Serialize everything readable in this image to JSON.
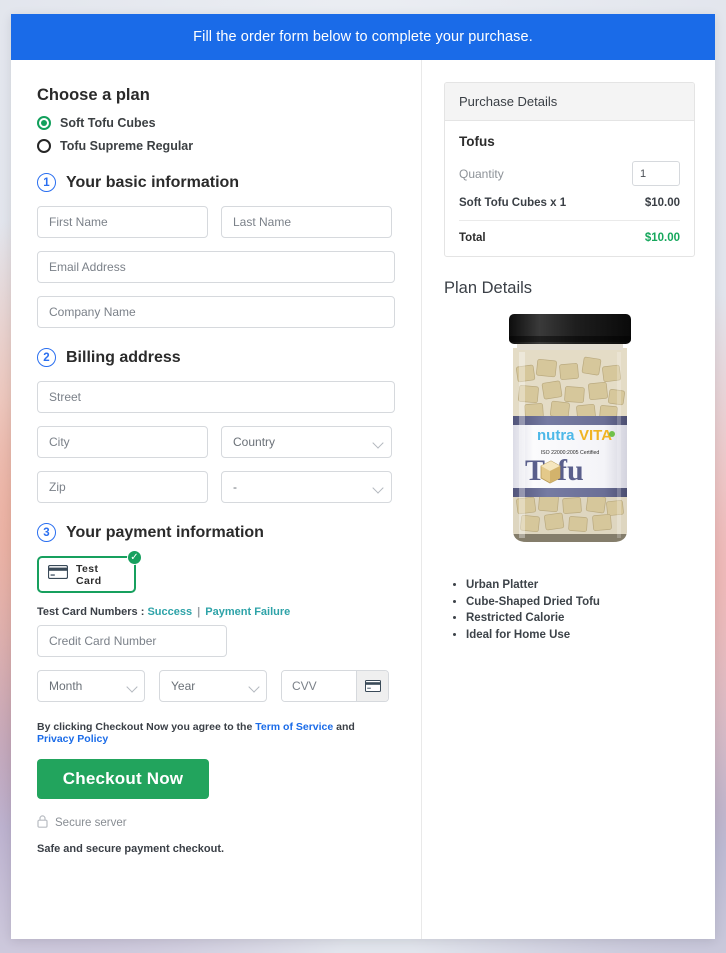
{
  "banner": {
    "text": "Fill the order form below to complete your purchase."
  },
  "plan": {
    "heading": "Choose a plan",
    "options": [
      {
        "label": "Soft Tofu Cubes",
        "selected": true
      },
      {
        "label": "Tofu Supreme Regular",
        "selected": false
      }
    ]
  },
  "steps": [
    {
      "number": "1",
      "label": "Your basic information"
    },
    {
      "number": "2",
      "label": "Billing address"
    },
    {
      "number": "3",
      "label": "Your payment information"
    }
  ],
  "basic_info": {
    "first_name_placeholder": "First Name",
    "last_name_placeholder": "Last Name",
    "email_placeholder": "Email Address",
    "company_placeholder": "Company Name"
  },
  "billing": {
    "street_placeholder": "Street",
    "city_placeholder": "City",
    "country_value": "Country",
    "zip_placeholder": "Zip",
    "state_value": "-"
  },
  "payment": {
    "method_label": "Test Card",
    "method_selected_icon": "check-icon",
    "card_icon": "credit-card-icon",
    "test_numbers_label": "Test Card Numbers :",
    "link_success": "Success",
    "link_separator": "|",
    "link_failure": "Payment Failure",
    "card_number_placeholder": "Credit Card Number",
    "month_value": "Month",
    "year_value": "Year",
    "cvv_placeholder": "CVV"
  },
  "terms": {
    "prefix": "By clicking Checkout Now you agree to the ",
    "link_terms": "Term of Service",
    "conjunction": " and ",
    "link_privacy": "Privacy Policy"
  },
  "checkout": {
    "button_label": "Checkout Now",
    "secure_label": "Secure server",
    "secure_icon": "lock-icon",
    "safe_note": "Safe and secure payment checkout."
  },
  "purchase_details": {
    "header": "Purchase Details",
    "product_name": "Tofus",
    "quantity_label": "Quantity",
    "quantity_value": "1",
    "line_item_label": "Soft Tofu Cubes x 1",
    "line_item_amount": "$10.00",
    "total_label": "Total",
    "total_amount": "$10.00"
  },
  "plan_details": {
    "title": "Plan Details",
    "product_image": {
      "brand_primary": "nutra",
      "brand_secondary": "VITA",
      "certification": "ISO 22000:2005 Certified",
      "product_word": "Tofu",
      "lid_color": "#1c1c1c",
      "label_band_color": "#6a6d96",
      "cube_color": "#d8c89a"
    },
    "features": [
      "Urban Platter",
      "Cube-Shaped Dried Tofu",
      "Restricted Calorie",
      "Ideal for Home Use"
    ]
  },
  "colors": {
    "banner_blue": "#1A6BE8",
    "accent_green": "#22a45d",
    "step_blue": "#2a6ff0",
    "link_teal": "#2ea3a8",
    "total_green": "#16a75c"
  }
}
